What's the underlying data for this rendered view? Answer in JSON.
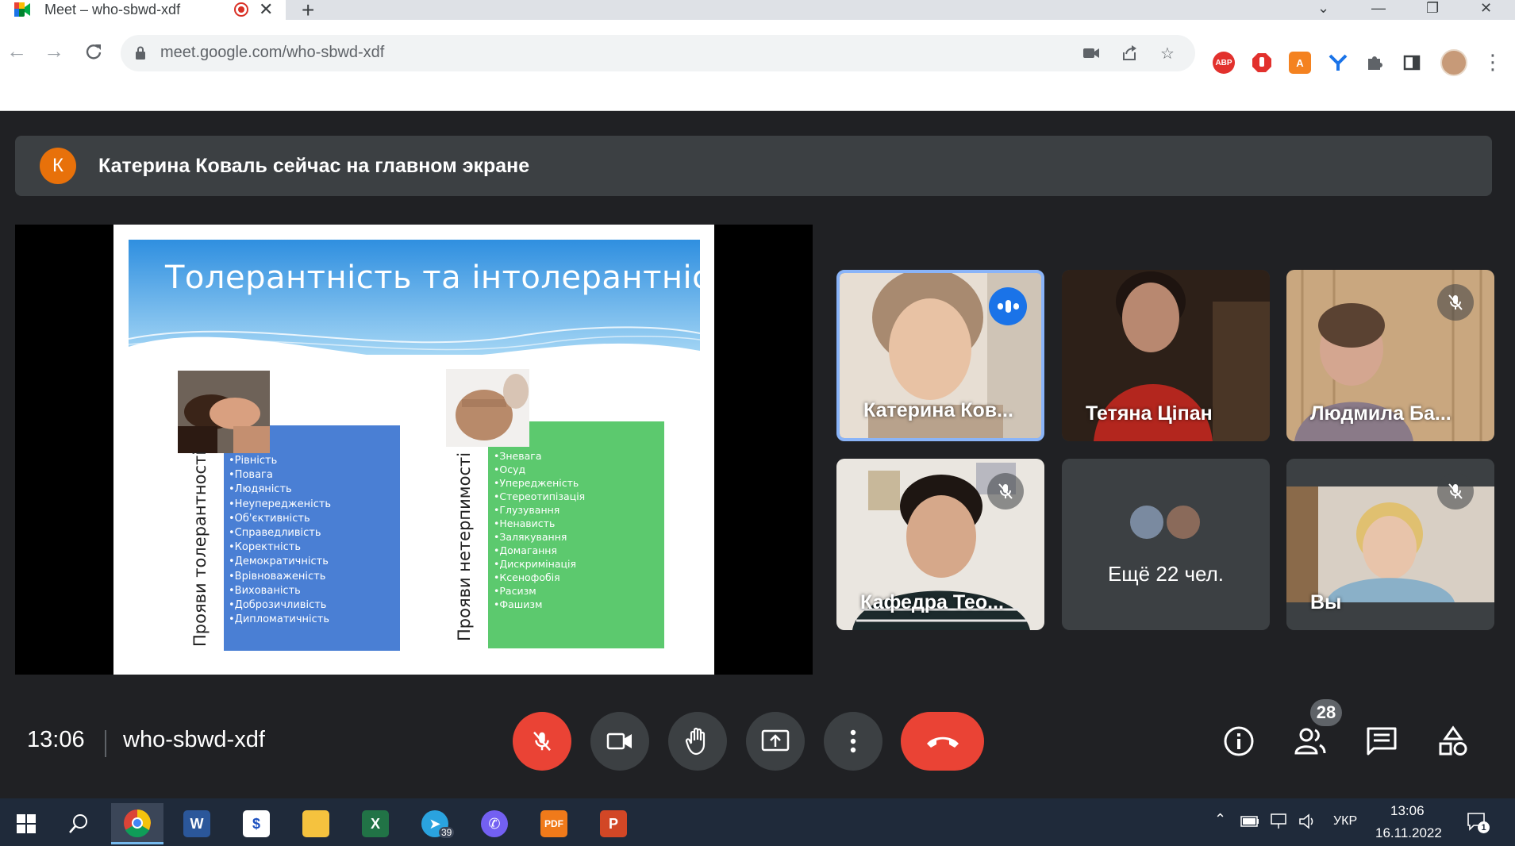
{
  "browser": {
    "tab_title": "Meet – who-sbwd-xdf",
    "url_host": "meet.google.com",
    "url_path": "/who-sbwd-xdf",
    "extensions": [
      {
        "name": "abp-icon",
        "label": "ABP",
        "color": "#e2312d"
      },
      {
        "name": "stop-extension-icon",
        "label": "",
        "color": "#e2312d"
      },
      {
        "name": "orange-extension-icon",
        "label": "A",
        "color": "#f48220"
      },
      {
        "name": "y-extension-icon",
        "label": "",
        "color": "#1a73e8"
      }
    ]
  },
  "banner": {
    "avatar_letter": "К",
    "text": "Катерина Коваль сейчас на главном экране"
  },
  "slide": {
    "title": "Толерантність та інтолерантність",
    "left_column": {
      "vertical_label": "Прояви толерантності",
      "color": "#4a7fd4",
      "items": [
        "Рівність",
        "Повага",
        "Людяність",
        "Неупередженість",
        "Об'єктивність",
        "Справедливість",
        "Коректність",
        "Демократичність",
        "Врівноваженість",
        "Вихованість",
        "Доброзичливість",
        "Дипломатичність"
      ]
    },
    "right_column": {
      "vertical_label": "Прояви нетерпимості",
      "color": "#5cc96e",
      "items": [
        "Зневага",
        "Осуд",
        "Упередженість",
        "Стереотипізація",
        "Глузування",
        "Ненависть",
        "Залякування",
        "Домагання",
        "Дискримінація",
        "Ксенофобія",
        "Расизм",
        "Фашизм"
      ]
    }
  },
  "participants": [
    {
      "name": "Катерина Ков...",
      "speaking": true,
      "muted": false
    },
    {
      "name": "Тетяна Ціпан",
      "speaking": false,
      "muted": false
    },
    {
      "name": "Людмила Ба...",
      "speaking": false,
      "muted": true
    },
    {
      "name": "Кафедра Тео...",
      "speaking": false,
      "muted": true
    },
    {
      "name": "Вы",
      "speaking": false,
      "muted": true
    }
  ],
  "more_tile": {
    "text": "Ещё 22 чел."
  },
  "meeting": {
    "time": "13:06",
    "code": "who-sbwd-xdf",
    "people_count": "28"
  },
  "taskbar": {
    "telegram_badge": "39",
    "language": "УКР",
    "time": "13:06",
    "date": "16.11.2022",
    "notifications": "1"
  },
  "colors": {
    "meet_bg": "#202124",
    "tile_bg": "#3c4043",
    "danger": "#ea4335",
    "accent": "#1a73e8"
  }
}
